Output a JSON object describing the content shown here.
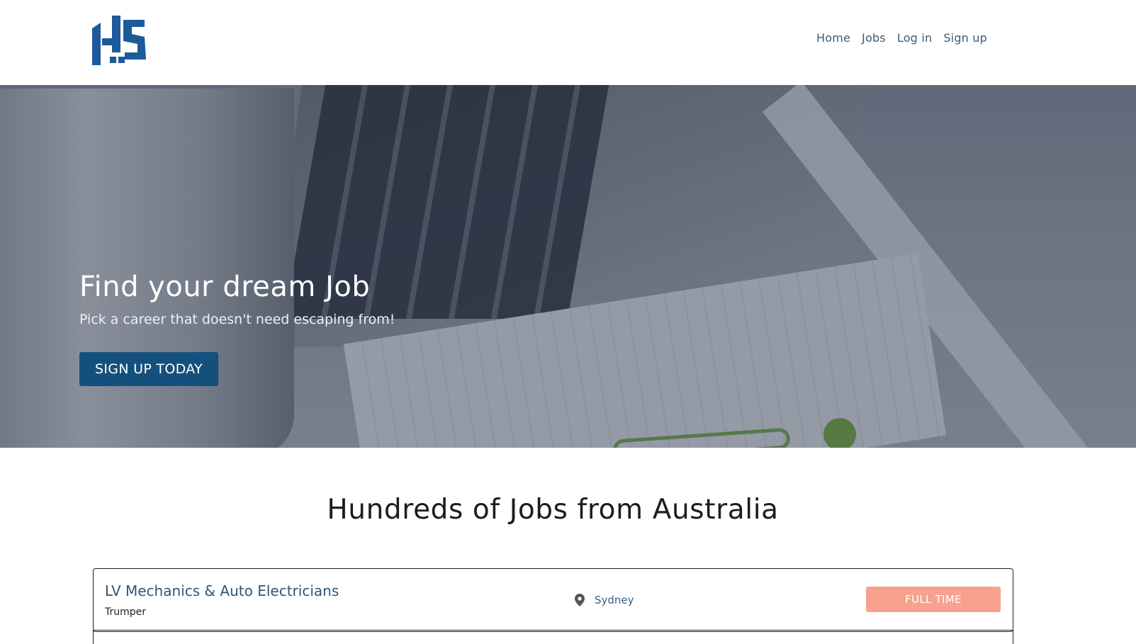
{
  "brand": {
    "logo_icon": "hs-logo-icon",
    "color": "#1d5a9a"
  },
  "nav": {
    "items": [
      {
        "label": "Home"
      },
      {
        "label": "Jobs"
      },
      {
        "label": "Log in"
      },
      {
        "label": "Sign up"
      }
    ]
  },
  "hero": {
    "title": "Find your dream Job",
    "subtitle": "Pick a career that doesn't need escaping from!",
    "cta_label": "SIGN UP TODAY",
    "cta_color": "#14507c"
  },
  "section": {
    "title": "Hundreds of Jobs from Australia"
  },
  "jobs": [
    {
      "title": "LV Mechanics & Auto Electricians",
      "company": "Trumper",
      "location": "Sydney",
      "location_icon": "map-pin-icon",
      "type": "FULL TIME",
      "type_color": "#f8a18e"
    }
  ]
}
